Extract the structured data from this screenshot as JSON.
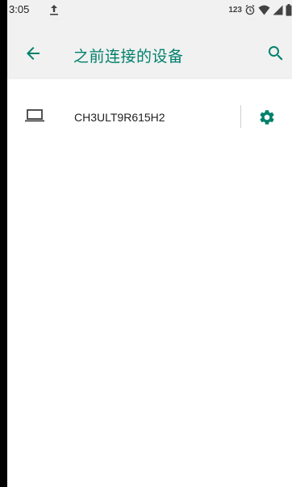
{
  "status_bar": {
    "time": "3:05",
    "upload_icon": "upload-icon",
    "right_icons": [
      "number-badge-icon",
      "alarm-icon",
      "wifi-icon",
      "signal-icon",
      "battery-icon"
    ],
    "number_badge_text": "123"
  },
  "app_bar": {
    "title": "之前连接的设备",
    "back_icon": "arrow-back-icon",
    "search_icon": "search-icon"
  },
  "devices": [
    {
      "name": "CH3ULT9R615H2",
      "icon": "laptop-icon",
      "settings_icon": "gear-icon"
    }
  ],
  "colors": {
    "accent": "#00806b",
    "status_bar_bg": "#f1f1f1",
    "app_bar_bg": "#f1f1f1",
    "text_primary": "#212121",
    "icon_gray": "#424242"
  }
}
